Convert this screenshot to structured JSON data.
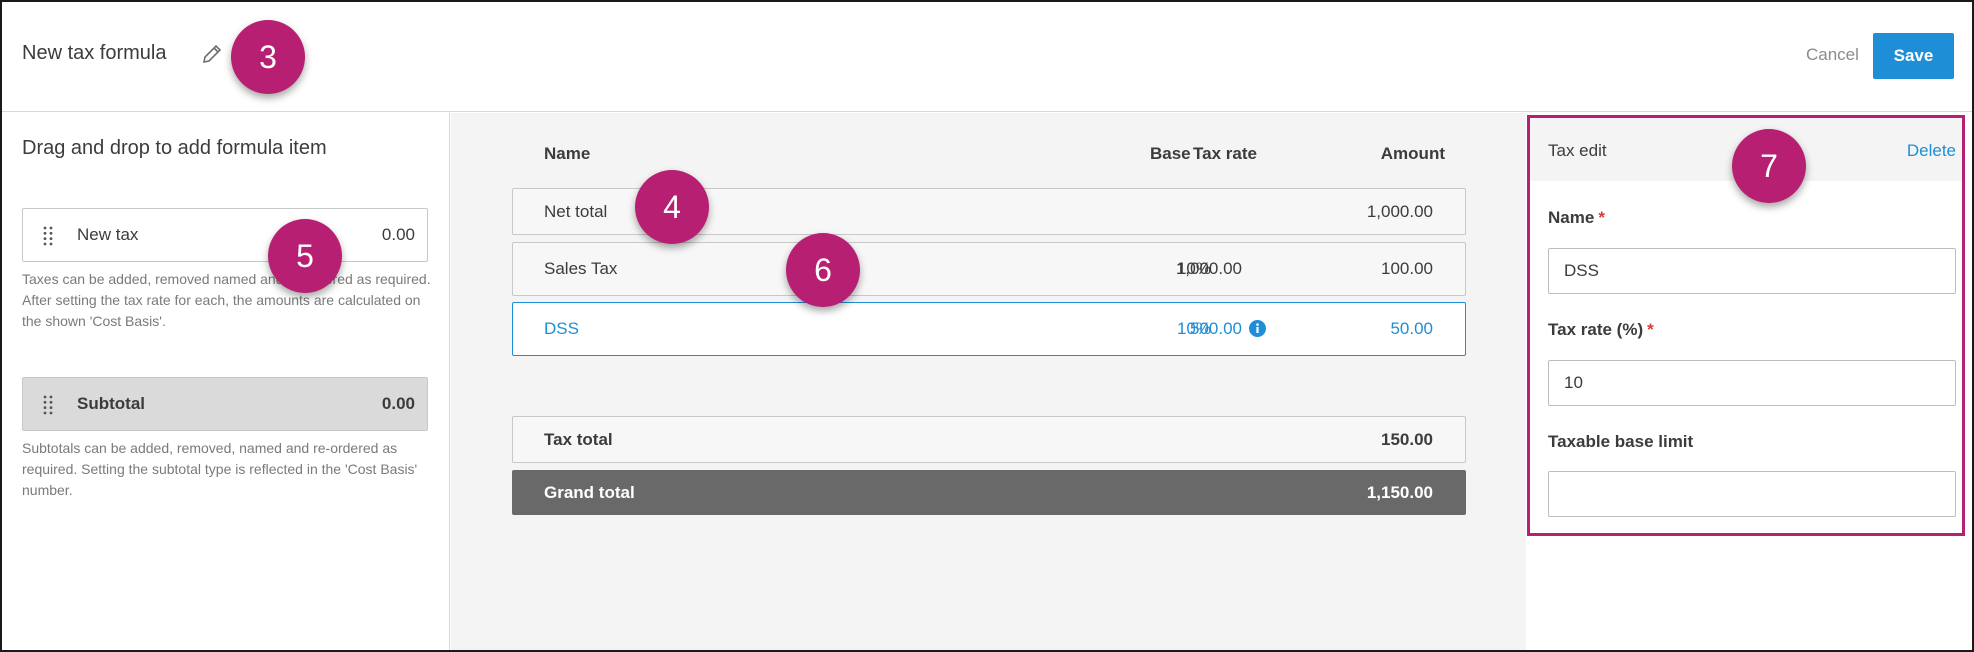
{
  "header": {
    "title": "New tax formula",
    "cancel_label": "Cancel",
    "save_label": "Save"
  },
  "callouts": [
    "3",
    "4",
    "5",
    "6",
    "7"
  ],
  "left_panel": {
    "heading": "Drag and drop to add formula item",
    "tax_item": {
      "label": "New tax",
      "value": "0.00"
    },
    "tax_help": "Taxes can be added, removed named and re-ordered as required. After setting the tax rate for each, the amounts are calculated on the shown 'Cost Basis'.",
    "subtotal_item": {
      "label": "Subtotal",
      "value": "0.00"
    },
    "subtotal_help": "Subtotals can be added, removed, named and re-ordered as required. Setting the subtotal type is reflected in the 'Cost Basis' number."
  },
  "table": {
    "columns": {
      "name": "Name",
      "tax_rate": "Tax rate",
      "base": "Base",
      "amount": "Amount"
    },
    "rows": [
      {
        "name": "Net total",
        "tax_rate": "",
        "base": "",
        "amount": "1,000.00"
      },
      {
        "name": "Sales Tax",
        "tax_rate": "10%",
        "base": "1,000.00",
        "amount": "100.00"
      },
      {
        "name": "DSS",
        "tax_rate": "10%",
        "base": "500.00",
        "amount": "50.00"
      }
    ],
    "tax_total": {
      "label": "Tax total",
      "amount": "150.00"
    },
    "grand_total": {
      "label": "Grand total",
      "amount": "1,150.00"
    }
  },
  "tax_edit": {
    "title": "Tax edit",
    "delete_label": "Delete",
    "name_label": "Name",
    "name_value": "DSS",
    "rate_label": "Tax rate (%)",
    "rate_value": "10",
    "limit_label": "Taxable base limit",
    "limit_value": "",
    "required_mark": "*"
  },
  "colors": {
    "accent": "#1e8fd6",
    "callout": "#b71f72",
    "grand_total_bg": "#696969",
    "required": "#d83a3a"
  },
  "icons": [
    "pencil-icon",
    "drag-handle-icon",
    "info-icon"
  ]
}
